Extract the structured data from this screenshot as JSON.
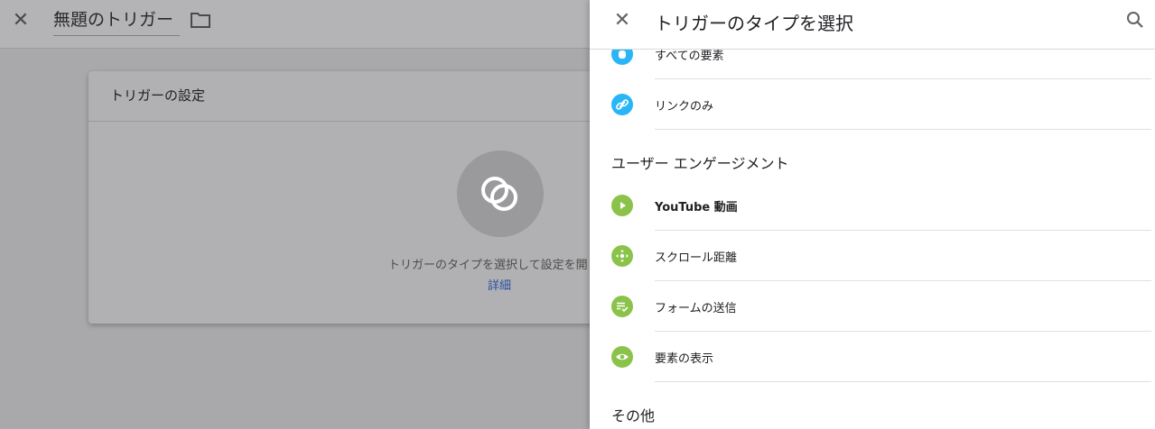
{
  "editor": {
    "title": "無題のトリガー",
    "card_title": "トリガーの設定",
    "card_description": "トリガーのタイプを選択して設定を開",
    "learn_more_link": "詳細"
  },
  "panel": {
    "title": "トリガーのタイプを選択",
    "items_clicks": [
      {
        "label": "すべての要素",
        "color": "#29b6f6"
      },
      {
        "label": "リンクのみ",
        "color": "#29b6f6"
      }
    ],
    "section_engagement": "ユーザー エンゲージメント",
    "items_engagement": [
      {
        "label": "YouTube 動画",
        "color": "#8bc34a"
      },
      {
        "label": "スクロール距離",
        "color": "#8bc34a"
      },
      {
        "label": "フォームの送信",
        "color": "#8bc34a"
      },
      {
        "label": "要素の表示",
        "color": "#8bc34a"
      }
    ],
    "section_other": "その他"
  },
  "colors": {
    "click_icon": "#29b6f6",
    "engagement_icon": "#8bc34a",
    "link": "#2950a0"
  },
  "icons": [
    "close-icon",
    "folder-icon",
    "search-icon",
    "cursor-icon",
    "link-icon",
    "play-icon",
    "move-icon",
    "form-check-icon",
    "eye-icon"
  ]
}
